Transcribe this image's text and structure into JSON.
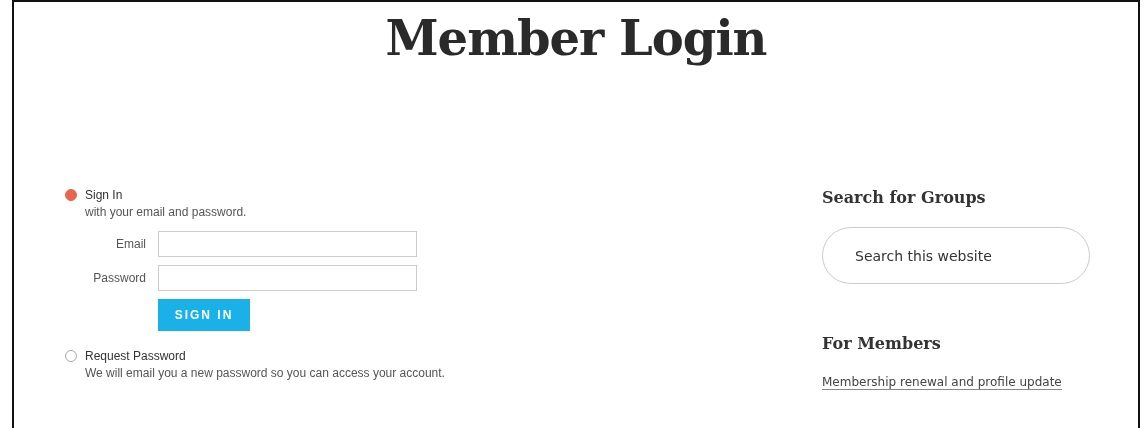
{
  "page_title": "Member Login",
  "login_options": [
    {
      "label": "Sign In",
      "description": "with your email and password.",
      "selected": true
    },
    {
      "label": "Request Password",
      "description": "We will email you a new password so you can access your account.",
      "selected": false
    }
  ],
  "fields": [
    {
      "label": "Email"
    },
    {
      "label": "Password"
    }
  ],
  "submit_button": "SIGN IN",
  "sidebar": {
    "search_heading": "Search for Groups",
    "search": {
      "placeholder": "Search this website"
    },
    "members_heading": "For Members",
    "links": [
      "Membership renewal and profile update"
    ]
  }
}
